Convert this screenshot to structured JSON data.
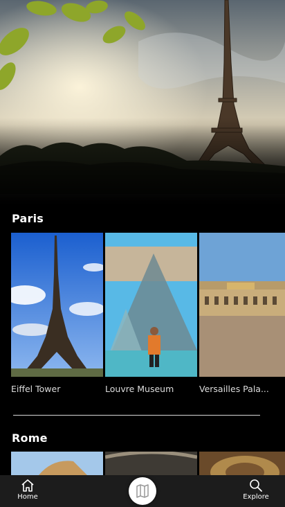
{
  "sections": [
    {
      "title": "Paris",
      "cards": [
        {
          "label": "Eiffel Tower"
        },
        {
          "label": "Louvre Museum"
        },
        {
          "label": "Versailles Pala..."
        }
      ]
    },
    {
      "title": "Rome",
      "cards": [
        {
          "label": ""
        },
        {
          "label": ""
        },
        {
          "label": ""
        }
      ]
    }
  ],
  "nav": {
    "home_label": "Home",
    "explore_label": "Explore",
    "home_icon": "home-icon",
    "explore_icon": "search-icon",
    "center_icon": "map-icon"
  },
  "colors": {
    "background": "#000000",
    "nav_background": "#1c1c1c",
    "text": "#ffffff"
  }
}
